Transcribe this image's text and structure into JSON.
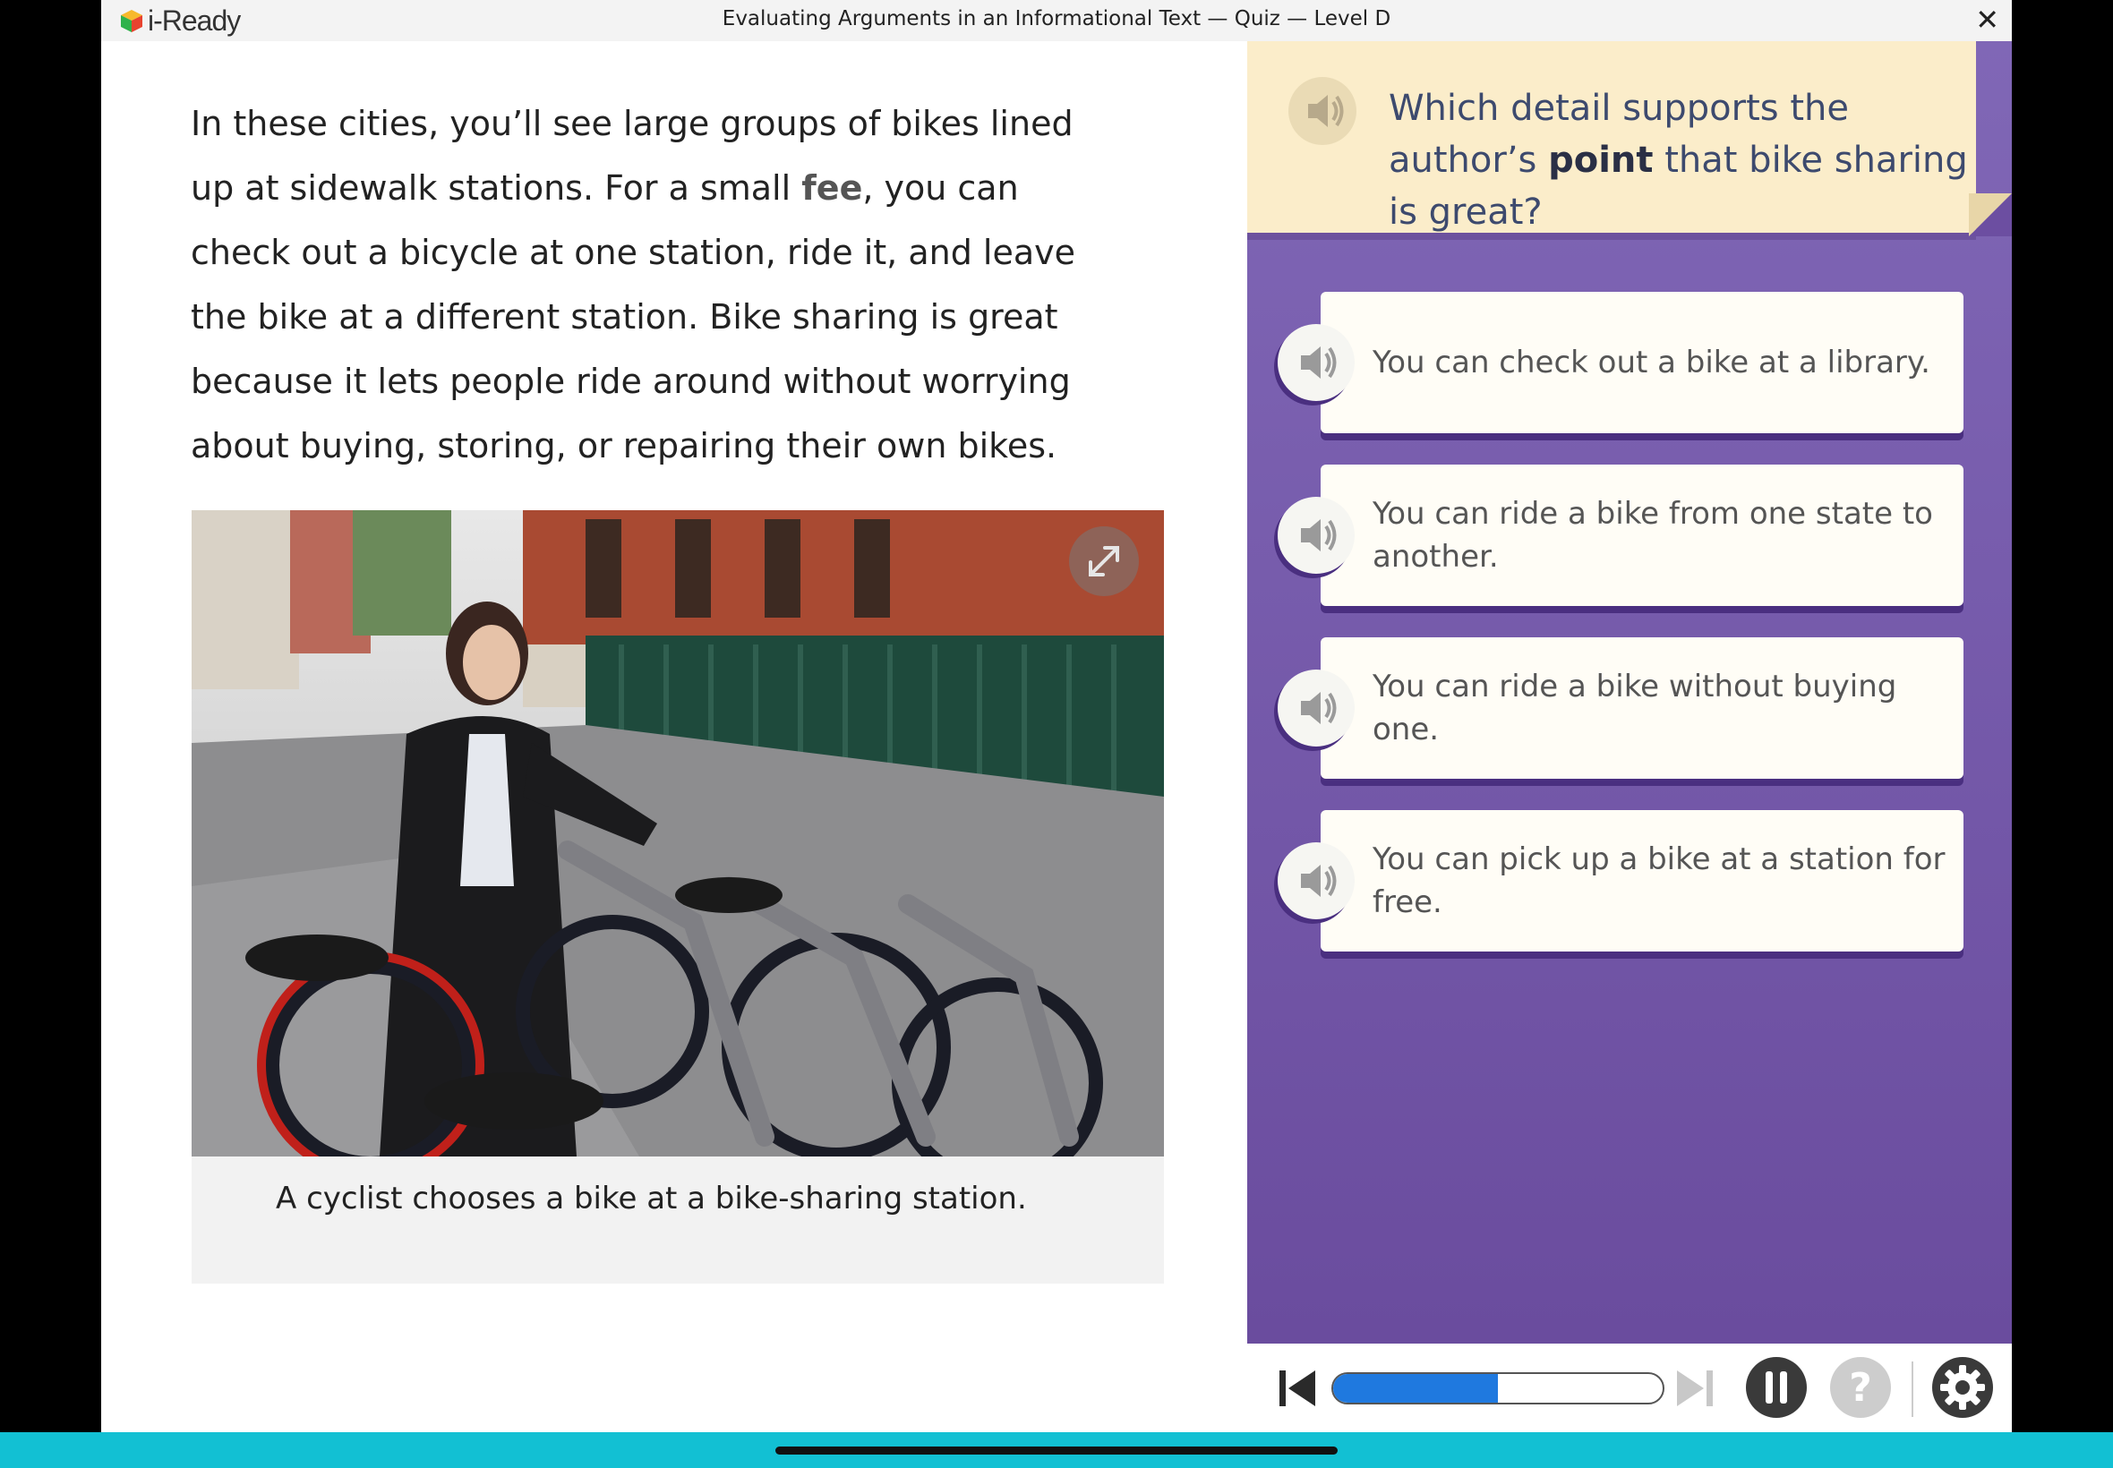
{
  "app": {
    "logo_text": "i-Ready",
    "title": "Evaluating Arguments in an Informational Text — Quiz — Level D",
    "close_glyph": "✕"
  },
  "passage": {
    "text_before": "In these cities, you’ll see large groups of bikes lined up at sidewalk stations. For a small ",
    "bold_word": "fee",
    "text_after": ", you can check out a bicycle at one station, ride it, and leave the bike at a different station. Bike sharing is great because it lets people ride around without worrying about buying, storing, or repairing their own bikes."
  },
  "image": {
    "caption": "A cyclist chooses a bike at a bike-sharing station.",
    "icon": "expand-icon"
  },
  "question": {
    "prompt_before": "Which detail supports the author’s ",
    "prompt_bold": "point",
    "prompt_after": " that bike sharing is great?",
    "speaker_icon": "speaker-icon"
  },
  "options": [
    "You can check out a bike at a library.",
    "You can ride a bike from one state to another.",
    "You can ride a bike without buying one.",
    "You can pick up a bike at a station for free."
  ],
  "player": {
    "progress": 0.5,
    "progress_color": "#1f79df",
    "icons": [
      "skip-back-icon",
      "skip-forward-icon",
      "pause-icon",
      "help-icon",
      "settings-icon"
    ]
  },
  "colors": {
    "panel_purple": "#7a5fb0",
    "prompt_bg": "#fbedca",
    "bottom_bar": "#12c0d3"
  }
}
